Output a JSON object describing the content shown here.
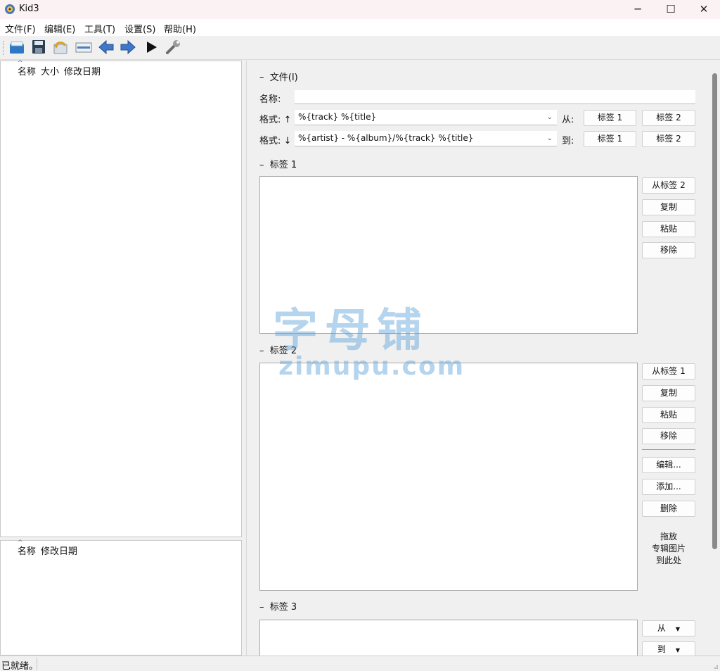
{
  "window": {
    "title": "Kid3"
  },
  "menu": [
    "文件(F)",
    "编辑(E)",
    "工具(T)",
    "设置(S)",
    "帮助(H)"
  ],
  "toolbar": {
    "icons": [
      "open-folder-icon",
      "save-icon",
      "revert-icon",
      "tag-panel-icon",
      "previous-arrow-icon",
      "next-arrow-icon",
      "play-icon",
      "settings-wrench-icon"
    ]
  },
  "file_list": {
    "columns": [
      "名称",
      "大小",
      "修改日期"
    ]
  },
  "dir_list": {
    "columns": [
      "名称",
      "修改日期"
    ]
  },
  "file_section": {
    "title": "文件(I)",
    "name_label": "名称:",
    "name_value": "",
    "format_up_label": "格式: ↑",
    "format_up_value": "%{track} %{title}",
    "from_label": "从:",
    "format_down_label": "格式: ↓",
    "format_down_value": "%{artist} - %{album}/%{track} %{title}",
    "to_label": "到:",
    "tag1_btn": "标签 1",
    "tag2_btn": "标签 2"
  },
  "tag1_section": {
    "title": "标签 1",
    "buttons": [
      "从标签 2",
      "复制",
      "粘贴",
      "移除"
    ]
  },
  "tag2_section": {
    "title": "标签 2",
    "buttons": [
      "从标签 1",
      "复制",
      "粘贴",
      "移除"
    ],
    "picture_buttons": [
      "编辑...",
      "添加...",
      "删除"
    ],
    "drop_text": [
      "拖放",
      "专辑图片",
      "到此处"
    ]
  },
  "tag3_section": {
    "title": "标签 3",
    "buttons": [
      "从",
      "到"
    ]
  },
  "watermark": {
    "cn": "字母铺",
    "en": "zimupu.com"
  },
  "status": {
    "text": "已就绪。"
  }
}
